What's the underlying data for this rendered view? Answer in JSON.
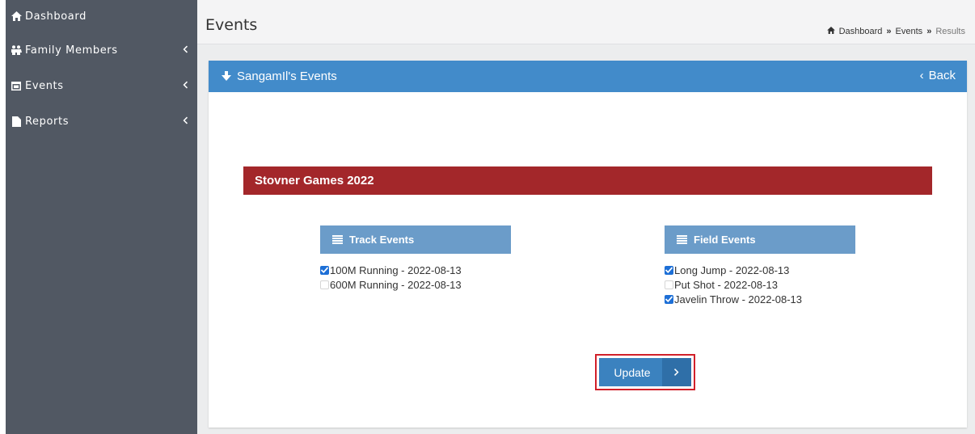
{
  "sidebar": {
    "items": [
      {
        "label": "Dashboard",
        "icon": "home-icon",
        "has_chevron": false
      },
      {
        "label": "Family Members",
        "icon": "family-icon",
        "has_chevron": true
      },
      {
        "label": "Events",
        "icon": "calendar-icon",
        "has_chevron": true
      },
      {
        "label": "Reports",
        "icon": "file-icon",
        "has_chevron": true
      }
    ]
  },
  "header": {
    "title": "Events",
    "breadcrumb": [
      "Dashboard",
      "Events",
      "Results"
    ],
    "breadcrumb_separator": "»"
  },
  "panel": {
    "title": "SangamIl's Events",
    "back_label": "Back",
    "back_chevron": "‹",
    "games_title": "Stovner Games 2022",
    "track": {
      "heading": "Track Events",
      "events": [
        {
          "label": "100M Running - 2022-08-13",
          "checked": true
        },
        {
          "label": "600M Running - 2022-08-13",
          "checked": false
        }
      ]
    },
    "field": {
      "heading": "Field Events",
      "events": [
        {
          "label": "Long Jump - 2022-08-13",
          "checked": true
        },
        {
          "label": "Put Shot - 2022-08-13",
          "checked": false
        },
        {
          "label": "Javelin Throw - 2022-08-13",
          "checked": true
        }
      ]
    },
    "update_label": "Update"
  },
  "colors": {
    "sidebar_bg": "#515863",
    "panel_heading_bg": "#428bca",
    "games_bar_bg": "#a3272a",
    "column_heading_bg": "#6b9cc9",
    "button_bg": "#3b82bf",
    "highlight_border": "#d1202a",
    "checkbox_checked": "#1d6fd6"
  }
}
